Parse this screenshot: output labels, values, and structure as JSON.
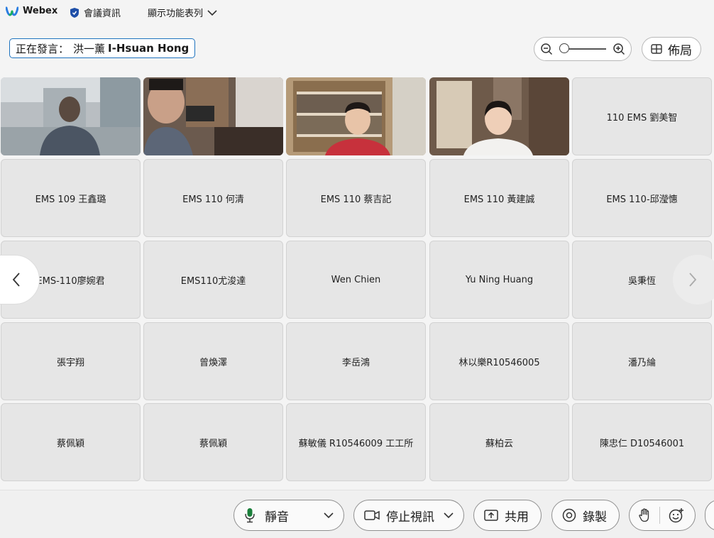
{
  "topbar": {
    "app_name": "Webex",
    "meeting_info": "會議資訊",
    "show_menu": "顯示功能表列"
  },
  "speaker": {
    "prefix": "正在發言：",
    "name_cn": "洪一薰",
    "name_en": "I-Hsuan Hong"
  },
  "zoom": {
    "level": 0.0
  },
  "layout": {
    "label": "佈局"
  },
  "tiles": [
    {
      "name": "",
      "video": true
    },
    {
      "name": "",
      "video": true
    },
    {
      "name": "",
      "video": true
    },
    {
      "name": "",
      "video": true
    },
    {
      "name": "110 EMS 劉美智",
      "video": false
    },
    {
      "name": "EMS 109 王鑫璐",
      "video": false
    },
    {
      "name": "EMS 110 何清",
      "video": false
    },
    {
      "name": "EMS 110 蔡吉記",
      "video": false
    },
    {
      "name": "EMS 110 黃建誠",
      "video": false
    },
    {
      "name": "EMS 110-邱瀅憓",
      "video": false
    },
    {
      "name": "EMS-110廖婉君",
      "video": false
    },
    {
      "name": "EMS110尤浚達",
      "video": false
    },
    {
      "name": "Wen Chien",
      "video": false
    },
    {
      "name": "Yu Ning Huang",
      "video": false
    },
    {
      "name": "吳秉恆",
      "video": false
    },
    {
      "name": "張宇翔",
      "video": false
    },
    {
      "name": "曾煥澤",
      "video": false
    },
    {
      "name": "李岳鴻",
      "video": false
    },
    {
      "name": "林以樂R10546005",
      "video": false
    },
    {
      "name": "潘乃綸",
      "video": false
    },
    {
      "name": "蔡佩穎",
      "video": false
    },
    {
      "name": "蔡佩穎",
      "video": false
    },
    {
      "name": "蘇敏儀 R10546009 工工所",
      "video": false
    },
    {
      "name": "蘇柏云",
      "video": false
    },
    {
      "name": "陳忠仁 D10546001",
      "video": false
    }
  ],
  "controls": {
    "mute": "靜音",
    "stop_video": "停止視訊",
    "share": "共用",
    "record": "錄製"
  },
  "icons": {
    "logo": "webex-logo-icon",
    "shield": "shield-icon",
    "chevron": "chevron-down-icon",
    "zoom_out": "zoom-out-icon",
    "zoom_in": "zoom-in-icon",
    "layout": "grid-layout-icon",
    "prev": "chevron-left-icon",
    "next": "chevron-right-icon",
    "mic": "microphone-icon",
    "camera": "camera-icon",
    "share": "share-icon",
    "record": "record-icon",
    "hand": "raise-hand-icon",
    "emoji": "emoji-icon"
  },
  "colors": {
    "accent": "#1e73be",
    "mic_green": "#1b7f3b"
  }
}
